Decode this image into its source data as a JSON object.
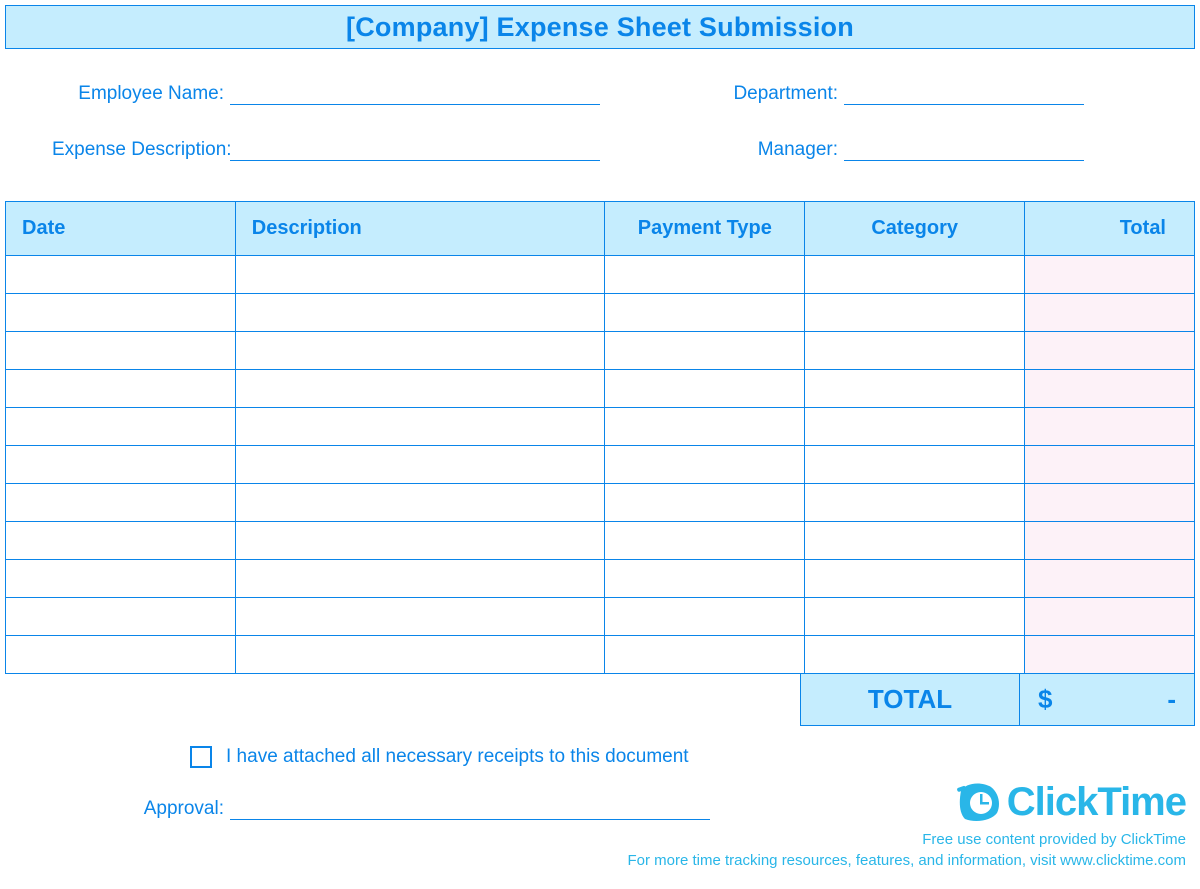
{
  "title": "[Company] Expense Sheet Submission",
  "meta": {
    "employee_name_label": "Employee Name:",
    "employee_name_value": "",
    "department_label": "Department:",
    "department_value": "",
    "expense_desc_label": "Expense Description:",
    "expense_desc_value": "",
    "manager_label": "Manager:",
    "manager_value": ""
  },
  "columns": {
    "date": "Date",
    "description": "Description",
    "payment_type": "Payment Type",
    "category": "Category",
    "total": "Total"
  },
  "rows": [
    {
      "date": "",
      "description": "",
      "payment_type": "",
      "category": "",
      "total": ""
    },
    {
      "date": "",
      "description": "",
      "payment_type": "",
      "category": "",
      "total": ""
    },
    {
      "date": "",
      "description": "",
      "payment_type": "",
      "category": "",
      "total": ""
    },
    {
      "date": "",
      "description": "",
      "payment_type": "",
      "category": "",
      "total": ""
    },
    {
      "date": "",
      "description": "",
      "payment_type": "",
      "category": "",
      "total": ""
    },
    {
      "date": "",
      "description": "",
      "payment_type": "",
      "category": "",
      "total": ""
    },
    {
      "date": "",
      "description": "",
      "payment_type": "",
      "category": "",
      "total": ""
    },
    {
      "date": "",
      "description": "",
      "payment_type": "",
      "category": "",
      "total": ""
    },
    {
      "date": "",
      "description": "",
      "payment_type": "",
      "category": "",
      "total": ""
    },
    {
      "date": "",
      "description": "",
      "payment_type": "",
      "category": "",
      "total": ""
    },
    {
      "date": "",
      "description": "",
      "payment_type": "",
      "category": "",
      "total": ""
    }
  ],
  "grand_total": {
    "label": "TOTAL",
    "currency": "$",
    "amount": "-"
  },
  "receipts": {
    "checked": false,
    "label": "I have attached all necessary receipts to this document"
  },
  "approval": {
    "label": "Approval:",
    "value": ""
  },
  "brand": {
    "name": "ClickTime",
    "line1": "Free use content provided by ClickTime",
    "line2": "For more time tracking resources, features, and information, visit www.clicktime.com"
  }
}
